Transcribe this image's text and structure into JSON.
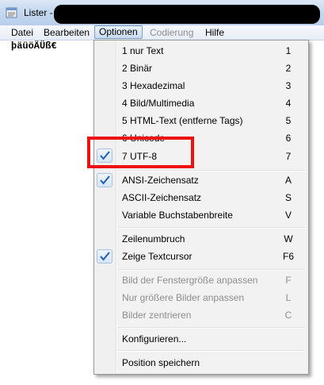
{
  "window": {
    "title": "Lister - ["
  },
  "menubar": {
    "items": [
      {
        "label": "Datei"
      },
      {
        "label": "Bearbeiten"
      },
      {
        "label": "Optionen"
      },
      {
        "label": "Codierung"
      },
      {
        "label": "Hilfe"
      }
    ]
  },
  "content": {
    "text": "þäüöÄÜß€"
  },
  "menu": {
    "items": [
      {
        "label": "1  nur Text",
        "key": "1"
      },
      {
        "label": "2  Binär",
        "key": "2"
      },
      {
        "label": "3  Hexadezimal",
        "key": "3"
      },
      {
        "label": "4  Bild/Multimedia",
        "key": "4"
      },
      {
        "label": "5  HTML-Text (entferne Tags)",
        "key": "5"
      },
      {
        "label": "6  Unicode",
        "key": "6"
      },
      {
        "label": "7  UTF-8",
        "key": "7",
        "checked": true
      },
      {
        "label": "ANSI-Zeichensatz",
        "key": "A",
        "checked": true
      },
      {
        "label": "ASCII-Zeichensatz",
        "key": "S"
      },
      {
        "label": "Variable Buchstabenbreite",
        "key": "V"
      },
      {
        "label": "Zeilenumbruch",
        "key": "W"
      },
      {
        "label": "Zeige Textcursor",
        "key": "F6",
        "checked": true
      },
      {
        "label": "Bild der Fenstergröße anpassen",
        "key": "F",
        "disabled": true
      },
      {
        "label": "Nur größere Bilder anpassen",
        "key": "L",
        "disabled": true
      },
      {
        "label": "Bilder zentrieren",
        "key": "C",
        "disabled": true
      },
      {
        "label": "Konfigurieren..."
      },
      {
        "label": "Position speichern"
      }
    ]
  },
  "colors": {
    "highlight_border": "#ee1111",
    "check_mark": "#1c5fb8"
  }
}
